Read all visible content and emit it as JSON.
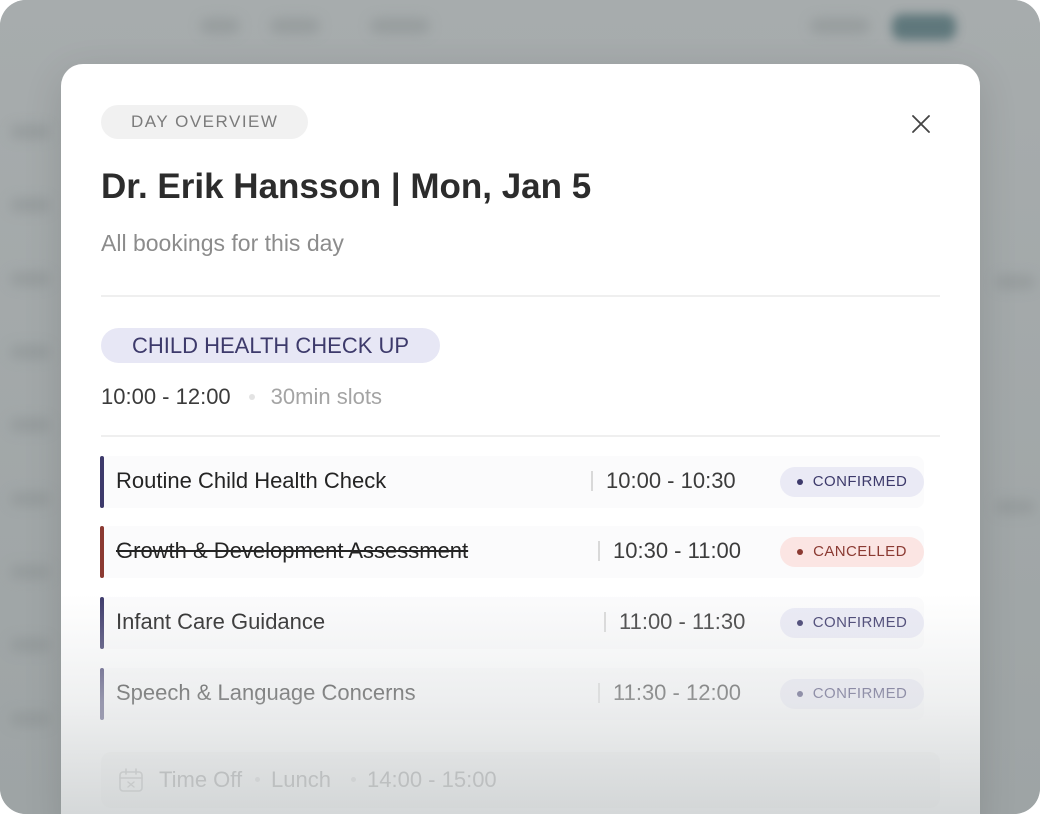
{
  "modal": {
    "badge": "DAY OVERVIEW",
    "title": "Dr. Erik Hansson | Mon, Jan 5",
    "subtitle": "All bookings for this day",
    "close_icon": "close-icon"
  },
  "service": {
    "name": "CHILD HEALTH CHECK UP",
    "time_range": "10:00 - 12:00",
    "slot_length": "30min slots"
  },
  "bookings": [
    {
      "name": "Routine Child Health Check",
      "time": "10:00 - 10:30",
      "status": "CONFIRMED",
      "cancelled": false
    },
    {
      "name": "Growth & Development Assessment",
      "time": "10:30 - 11:00",
      "status": "CANCELLED",
      "cancelled": true
    },
    {
      "name": "Infant Care Guidance",
      "time": "11:00 - 11:30",
      "status": "CONFIRMED",
      "cancelled": false
    },
    {
      "name": "Speech & Language Concerns",
      "time": "11:30 - 12:00",
      "status": "CONFIRMED",
      "cancelled": false
    }
  ],
  "time_off": {
    "icon": "calendar-icon",
    "label": "Time Off",
    "reason": "Lunch",
    "time": "14:00 - 15:00"
  },
  "colors": {
    "confirmed_accent": "#3d3a6b",
    "cancelled_accent": "#8b3a32",
    "confirmed_bg": "#eaeaf5",
    "cancelled_bg": "#fbe5e3"
  }
}
